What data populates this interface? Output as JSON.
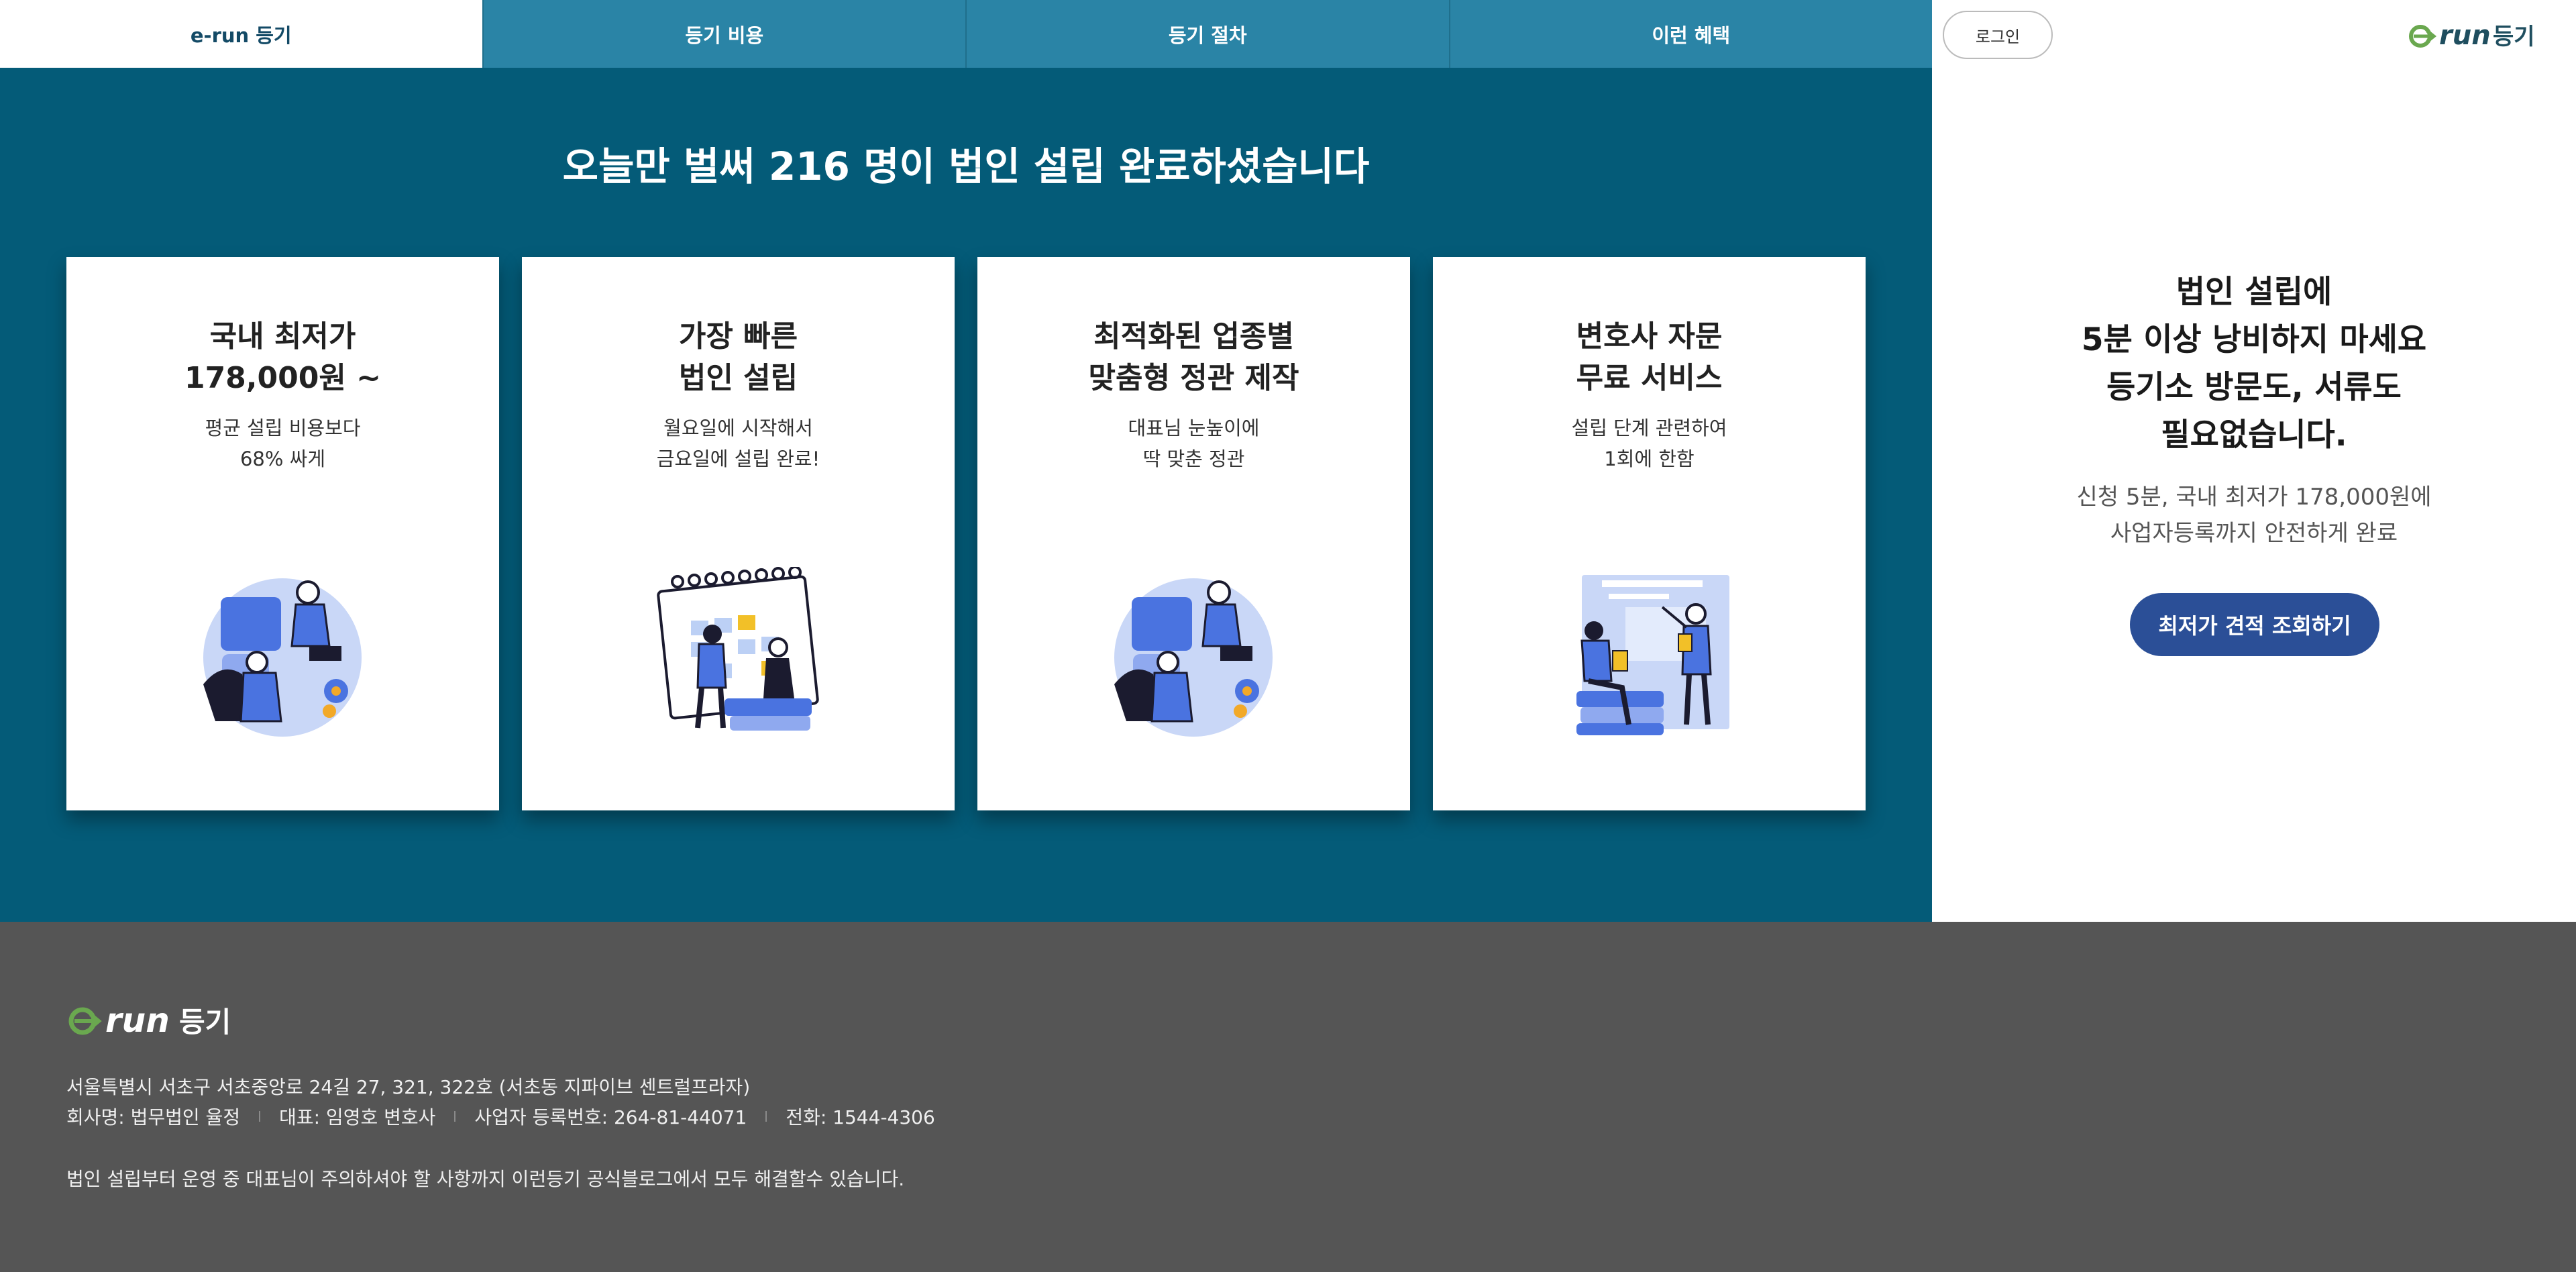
{
  "nav": {
    "tabs": [
      {
        "label": "e-run 등기"
      },
      {
        "label": "등기 비용"
      },
      {
        "label": "등기 절차"
      },
      {
        "label": "이런 혜택"
      }
    ]
  },
  "header": {
    "login_label": "로그인",
    "logo_text": "e-run 등기"
  },
  "main": {
    "heading": "오늘만 벌써  216 명이 법인 설립 완료하셨습니다",
    "cards": [
      {
        "title1": "국내 최저가",
        "title2": "178,000원 ~",
        "desc1": "평균 설립 비용보다",
        "desc2": "68% 싸게",
        "illustration": "puzzle-team-illustration"
      },
      {
        "title1": "가장 빠른",
        "title2": "법인 설립",
        "desc1": "월요일에 시작해서",
        "desc2": "금요일에 설립 완료!",
        "illustration": "calendar-planning-illustration"
      },
      {
        "title1": "최적화된 업종별",
        "title2": "맞춤형 정관 제작",
        "desc1": "대표님 눈높이에",
        "desc2": "딱 맞춘 정관",
        "illustration": "puzzle-team-illustration"
      },
      {
        "title1": "변호사 자문",
        "title2": "무료 서비스",
        "desc1": "설립 단계 관련하여",
        "desc2": "1회에 한함",
        "illustration": "presentation-board-illustration"
      }
    ]
  },
  "side": {
    "heading": [
      "법인 설립에",
      "5분 이상 낭비하지 마세요",
      "등기소 방문도, 서류도",
      "필요없습니다."
    ],
    "sub": [
      "신청 5분, 국내 최저가 178,000원에",
      "사업자등록까지 안전하게 완료"
    ],
    "cta_label": "최저가 견적 조회하기"
  },
  "footer": {
    "address": "서울특별시 서초구 서초중앙로 24길 27, 321, 322호 (서초동 지파이브 센트럴프라자)",
    "company": "회사명: 법무법인 율정",
    "ceo": "대표: 임영호 변호사",
    "biz_no": "사업자 등록번호: 264-81-44071",
    "phone": "전화: 1544-4306",
    "blog_text": "법인 설립부터 운영 중 대표님이 주의하셔야 할 사항까지 이런등기 공식블로그에서 모두 해결할수 있습니다."
  },
  "colors": {
    "main_bg": "#045b78",
    "tab_bg": "#2a84a6",
    "cta_bg": "#2b4f97",
    "footer_bg": "#555555",
    "logo_green": "#6aa84f",
    "logo_dark": "#1f4e5f"
  }
}
